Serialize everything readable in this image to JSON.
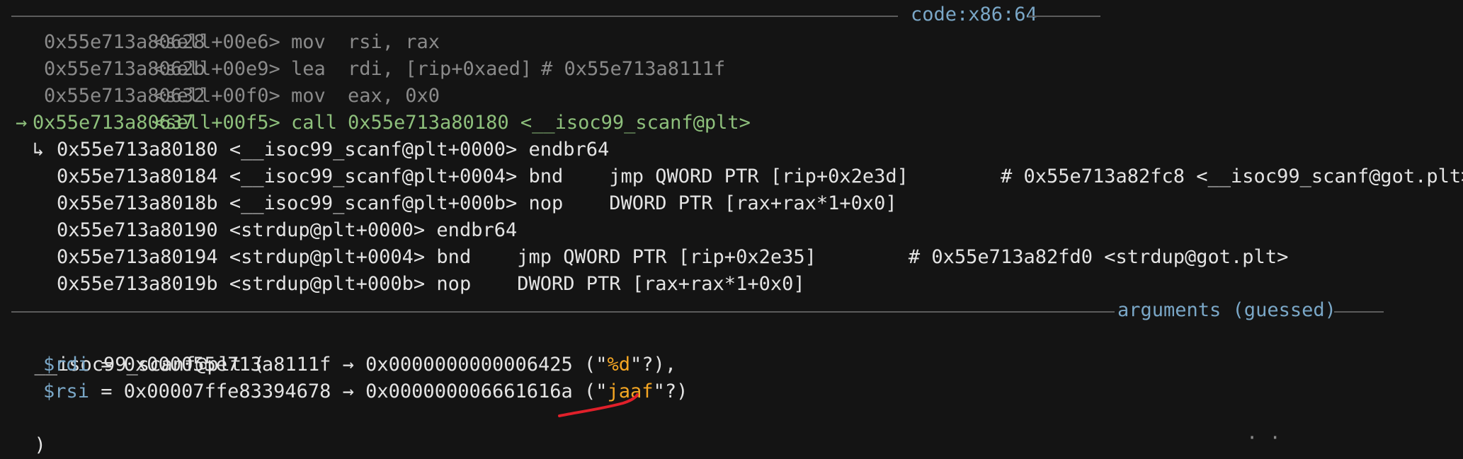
{
  "top_partial": "'",
  "code_section": {
    "label": "code:x86:64",
    "past_lines": [
      {
        "addr": "0x55e713a80628",
        "sym": "<sell+00e6>",
        "mnem": "mov",
        "ops": "rsi, rax",
        "comment": ""
      },
      {
        "addr": "0x55e713a8062b",
        "sym": "<sell+00e9>",
        "mnem": "lea",
        "ops": "rdi, [rip+0xaed]",
        "comment": "# 0x55e713a8111f"
      },
      {
        "addr": "0x55e713a80632",
        "sym": "<sell+00f0>",
        "mnem": "mov",
        "ops": "eax, 0x0",
        "comment": ""
      }
    ],
    "current_line": {
      "arrow": "→",
      "addr": "0x55e713a80637",
      "sym": "<sell+00f5>",
      "mnem": "call",
      "ops": "0x55e713a80180 <__isoc99_scanf@plt>"
    },
    "branch_arrow": "↳",
    "target_lines": [
      {
        "text": "0x55e713a80180 <__isoc99_scanf@plt+0000> endbr64"
      },
      {
        "text": "0x55e713a80184 <__isoc99_scanf@plt+0004> bnd    jmp QWORD PTR [rip+0x2e3d]        # 0x55e713a82fc8 <__isoc99_scanf@got.plt>"
      },
      {
        "text": "0x55e713a8018b <__isoc99_scanf@plt+000b> nop    DWORD PTR [rax+rax*1+0x0]"
      },
      {
        "text": "0x55e713a80190 <strdup@plt+0000> endbr64"
      },
      {
        "text": "0x55e713a80194 <strdup@plt+0004> bnd    jmp QWORD PTR [rip+0x2e35]        # 0x55e713a82fd0 <strdup@got.plt>"
      },
      {
        "text": "0x55e713a8019b <strdup@plt+000b> nop    DWORD PTR [rax+rax*1+0x0]"
      }
    ]
  },
  "args_section": {
    "label": "arguments (guessed)",
    "func_open": "__isoc99_scanf@plt (",
    "args": [
      {
        "reg": "$rdi",
        "mid": " = 0x000055e713a8111f → 0x0000000000006425 (\"",
        "str": "%d",
        "tail": "\"?),"
      },
      {
        "reg": "$rsi",
        "mid": " = 0x00007ffe83394678 → 0x000000006661616a (\"",
        "str": "jaaf",
        "tail": "\"?)"
      }
    ],
    "func_close": ")"
  },
  "colors": {
    "background": "#141414",
    "separator": "#5c5c5c",
    "label": "#7aa7c7",
    "current": "#8ec07c",
    "string": "#f5a623",
    "annotation": "#e0202a"
  }
}
